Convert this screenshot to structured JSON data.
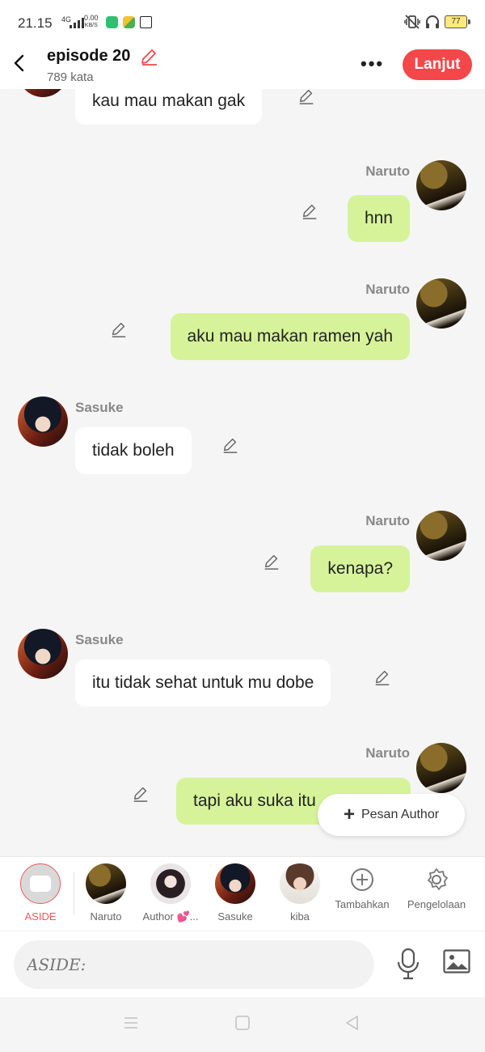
{
  "status": {
    "time": "21.15",
    "network": "4G",
    "speed_value": "0.00",
    "speed_unit": "KB/S",
    "battery": "77"
  },
  "header": {
    "title": "episode 20",
    "word_count": "789 kata",
    "continue_label": "Lanjut"
  },
  "messages": [
    {
      "side": "left",
      "name": "",
      "text": "kau mau makan gak"
    },
    {
      "side": "right",
      "name": "Naruto",
      "text": "hnn"
    },
    {
      "side": "right",
      "name": "Naruto",
      "text": "aku mau makan ramen yah"
    },
    {
      "side": "left",
      "name": "Sasuke",
      "text": "tidak boleh"
    },
    {
      "side": "right",
      "name": "Naruto",
      "text": "kenapa?"
    },
    {
      "side": "left",
      "name": "Sasuke",
      "text": "itu tidak sehat untuk mu dobe"
    },
    {
      "side": "right",
      "name": "Naruto",
      "text": "tapi aku suka itu"
    }
  ],
  "author_message_label": "Pesan Author",
  "characters": [
    {
      "label": "ASIDE",
      "icon": "aside-icon",
      "active": true
    },
    {
      "label": "Naruto",
      "icon": "naruto-avatar"
    },
    {
      "label": "Author 💕...",
      "icon": "author-avatar"
    },
    {
      "label": "Sasuke",
      "icon": "sasuke-avatar"
    },
    {
      "label": "kiba",
      "icon": "kiba-avatar"
    },
    {
      "label": "Tambahkan",
      "icon": "plus-circle-icon"
    },
    {
      "label": "Pengelolaan",
      "icon": "gear-icon"
    }
  ],
  "input": {
    "placeholder": "ASIDE:"
  },
  "colors": {
    "accent": "#f4474a",
    "right_bubble": "#d6f39a",
    "left_bubble": "#ffffff"
  }
}
